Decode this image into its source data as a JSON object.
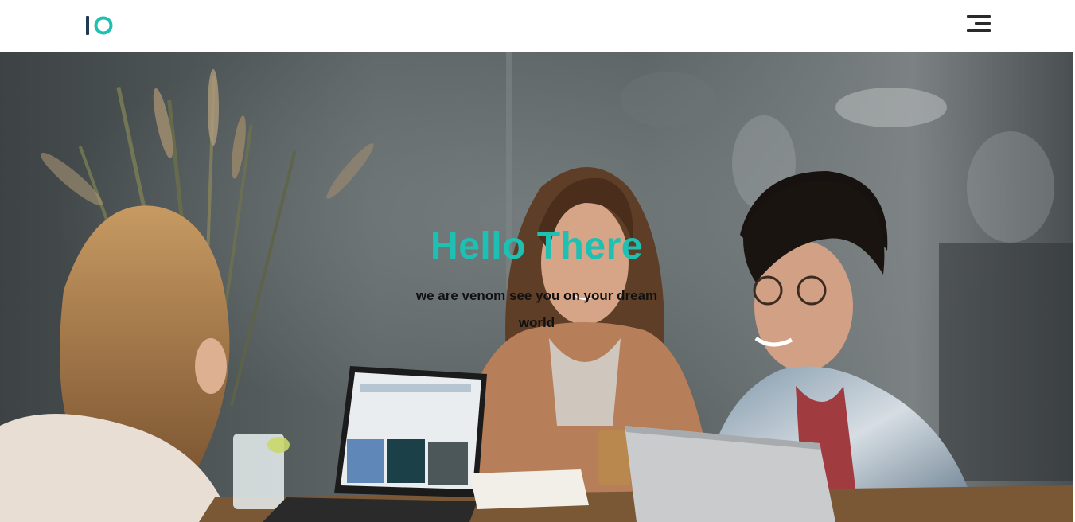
{
  "header": {
    "logo_text": "IO",
    "menu_icon": "hamburger-menu-icon"
  },
  "hero": {
    "title": "Hello There",
    "subtitle": "we are venom see you on your dream world",
    "photo": "people-laughing-at-table-with-laptops-photo"
  },
  "colors": {
    "accent": "#1ec0b4",
    "logo_bar": "#1f3a52",
    "header_bg": "#ffffff",
    "menu_bar": "#2a2a2a"
  }
}
